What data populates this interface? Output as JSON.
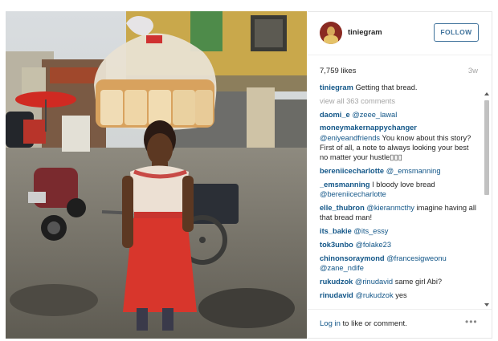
{
  "post": {
    "username": "tiniegram",
    "follow_label": "FOLLOW",
    "likes": "7,759 likes",
    "age": "3w",
    "caption": {
      "user": "tiniegram",
      "text": "Getting that bread."
    },
    "view_all": "view all 363 comments",
    "comments": [
      {
        "user": "daomi_e",
        "text": "",
        "mention": "@zeee_lawal"
      },
      {
        "user": "moneymakernappychanger",
        "text": "You know about this story? First of all, a note to always looking your best no matter your hustle▯▯▯",
        "mention": "@eniyeandfriends"
      },
      {
        "user": "bereniicecharlotte",
        "text": "",
        "mention": "@_emsmanning"
      },
      {
        "user": "_emsmanning",
        "text": "I bloody love bread",
        "mention": "@bereniicecharlotte"
      },
      {
        "user": "elle_thubron",
        "text": "imagine having all that bread man!",
        "mention": "@kieranmcthy"
      },
      {
        "user": "its_bakie",
        "text": "",
        "mention": "@its_essy"
      },
      {
        "user": "tok3unbo",
        "text": "",
        "mention": "@folake23"
      },
      {
        "user": "chinonsoraymond",
        "text": "",
        "mention": "@francesigweonu @zane_ndife"
      },
      {
        "user": "rukudzok",
        "text": "same girl Abi?",
        "mention": "@rinudavid"
      },
      {
        "user": "rinudavid",
        "text": "yes",
        "mention": "@rukudzok"
      }
    ],
    "footer": {
      "login_link": "Log in",
      "login_rest": " to like or comment.",
      "more": "•••"
    }
  },
  "colors": {
    "link": "#125688",
    "follow_border": "#3f729b",
    "muted": "#a5a5a5",
    "text": "#262626"
  },
  "icons": [
    "avatar",
    "more-options-icon",
    "scroll-up-icon",
    "scroll-down-icon"
  ]
}
